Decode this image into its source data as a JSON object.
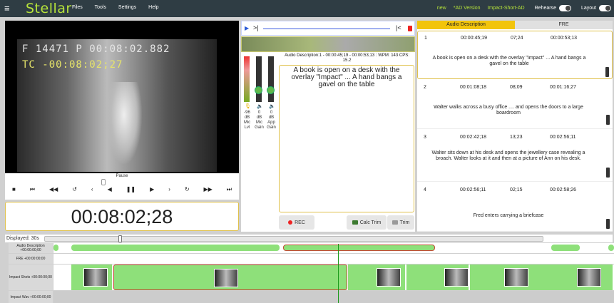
{
  "topbar": {
    "brand": "Stellar",
    "menu": [
      "Files",
      "Tools",
      "Settings",
      "Help"
    ],
    "status_new": "new",
    "ad_version": "*AD Version",
    "impact_short": "Impact-Short-AD",
    "rehearse_label": "Rehearse",
    "layout_label": "Layout"
  },
  "video": {
    "overlay_line1": "F 14471 P 00:08:02.882",
    "overlay_line2": "TC -00:08:02;27"
  },
  "transport": {
    "state_label": "Pause",
    "timecode": "00:08:02;28"
  },
  "audio_desc": {
    "info": "Audio Description:1 - 00:00:45;19 - 00:00:53;13 : WPM: 143 CPS: 15.2",
    "text": "A book is open on a desk with the overlay \"Impact\" ... A hand bangs a gavel on the table",
    "meter_labels": [
      [
        "-96",
        "dB",
        "Mic",
        "Lvl"
      ],
      [
        "0",
        "dB",
        "Mic",
        "Gain"
      ],
      [
        "0",
        "dB",
        "App",
        "Gain"
      ]
    ],
    "rec_label": "REC",
    "calc_trim_label": "Calc Trim",
    "trim_label": "Trim"
  },
  "tabs": {
    "active": "Audio Description",
    "inactive": "FRE"
  },
  "cues": [
    {
      "num": "1",
      "start": "00:00:45;19",
      "dur": "07;24",
      "end": "00:00:53;13",
      "text": "A book is open on a desk with the overlay \"Impact\" ... A hand bangs a gavel on the table"
    },
    {
      "num": "2",
      "start": "00:01:08;18",
      "dur": "08;09",
      "end": "00:01:16;27",
      "text": "Walter walks across a busy office .... and opens the doors to a large boardroom"
    },
    {
      "num": "3",
      "start": "00:02:42;18",
      "dur": "13;23",
      "end": "00:02:56;11",
      "text": "Walter sits down at his desk and opens  the jewellery case revealing a broach. Walter looks at it and then at a picture of Ann on his desk."
    },
    {
      "num": "4",
      "start": "00:02:56;11",
      "dur": "02;15",
      "end": "00:02:58;26",
      "text": "Fred enters carrying a briefcase"
    }
  ],
  "timeline": {
    "displayed_label": "Displayed: 30s",
    "tracks": [
      {
        "name": "Audio Description",
        "offset": "+00:00:00;00"
      },
      {
        "name": "FRE",
        "offset": "+00:00:00;00"
      },
      {
        "name": "Impact Shots",
        "offset": "+00:00:00;00"
      },
      {
        "name": "Impact Wav",
        "offset": "+00:00:00;00"
      }
    ]
  },
  "colors": {
    "brand": "#b6e33a",
    "accent": "#f2c40c",
    "segment": "#8ee07a",
    "playhead": "#1a9a1a"
  }
}
